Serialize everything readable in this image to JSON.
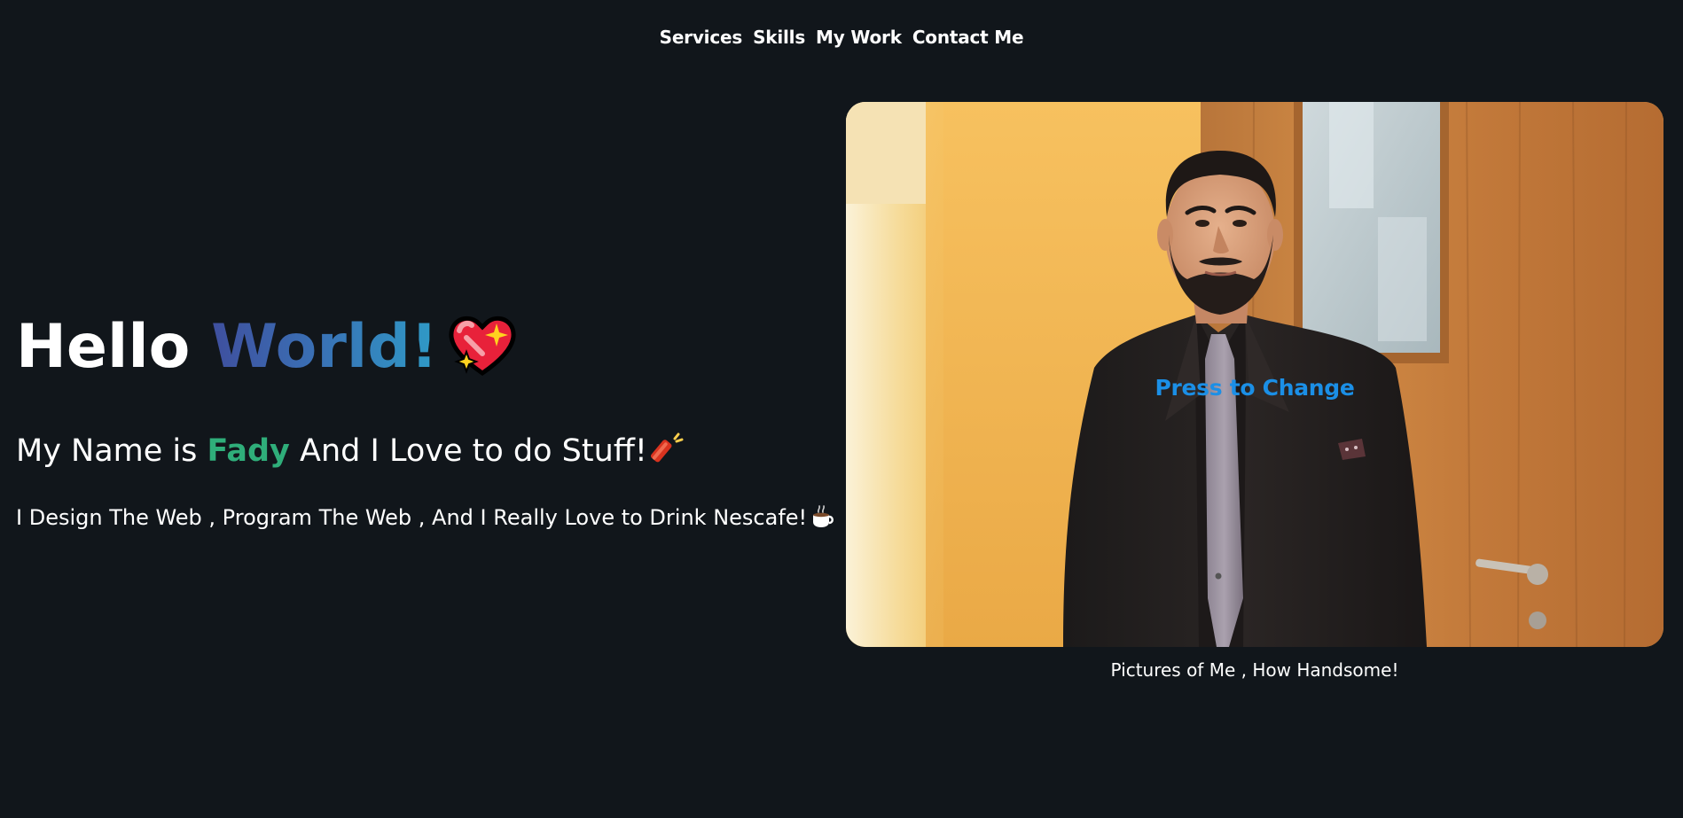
{
  "nav": {
    "items": [
      "Services",
      "Skills",
      "My Work",
      "Contact Me"
    ]
  },
  "hero": {
    "title_hello": "Hello",
    "title_world": "World!",
    "title_icon": "sparkling-heart-icon",
    "subtitle_prefix": "My Name is",
    "subtitle_name": "Fady",
    "subtitle_suffix": "And I Love to do Stuff!",
    "subtitle_icon": "firecracker-icon",
    "tagline": "I Design The Web , Program The Web , And I Really Love to Drink Nescafe!",
    "tagline_icon": "hot-beverage-icon"
  },
  "photo": {
    "button_label": "Press to Change",
    "caption": "Pictures of Me , How Handsome!"
  },
  "colors": {
    "background": "#11161b",
    "name_accent": "#2fae7a",
    "press_label": "#1b8fe6",
    "world_gradient_start": "#3f4f9e",
    "world_gradient_end": "#2f9bc7"
  }
}
